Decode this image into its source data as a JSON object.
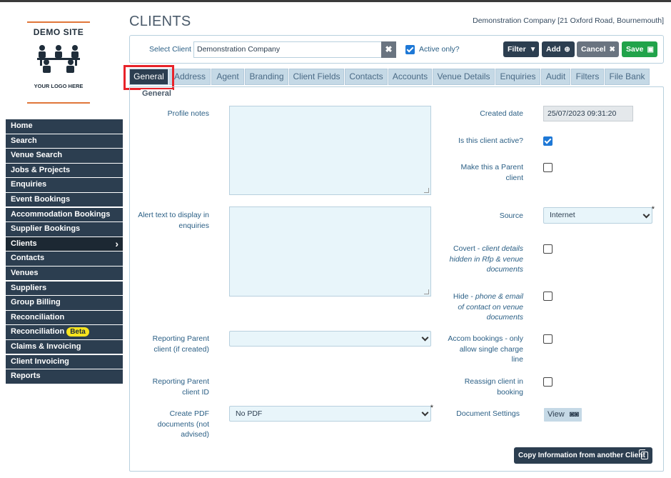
{
  "logo": {
    "brand": "DEMO SITE",
    "tagline": "YOUR LOGO HERE",
    "icon": "people-table-icon"
  },
  "sidebar": {
    "items": [
      {
        "label": "Home"
      },
      {
        "label": "Search"
      },
      {
        "label": "Venue Search"
      },
      {
        "label": "Jobs & Projects"
      },
      {
        "label": "Enquiries"
      },
      {
        "label": "Event Bookings"
      },
      {
        "label": "Accommodation Bookings"
      },
      {
        "label": "Supplier Bookings"
      },
      {
        "label": "Clients",
        "active": true
      },
      {
        "label": "Contacts"
      },
      {
        "label": "Venues"
      },
      {
        "label": "Suppliers"
      },
      {
        "label": "Group Billing"
      },
      {
        "label": "Reconciliation"
      },
      {
        "label": "Reconciliation",
        "badge": "Beta"
      },
      {
        "label": "Claims & Invoicing"
      },
      {
        "label": "Client Invoicing"
      },
      {
        "label": "Reports"
      }
    ]
  },
  "header": {
    "title": "CLIENTS",
    "company": "Demonstration Company [21 Oxford Road, Bournemouth]"
  },
  "select_bar": {
    "label": "Select Client",
    "value": "Demonstration Company",
    "active_only_label": "Active only?",
    "active_only_checked": true,
    "buttons": {
      "filter": "Filter",
      "add": "Add",
      "cancel": "Cancel",
      "save": "Save"
    }
  },
  "tabs": [
    "General",
    "Address",
    "Agent",
    "Branding",
    "Client Fields",
    "Contacts",
    "Accounts",
    "Venue Details",
    "Enquiries",
    "Audit",
    "Filters",
    "File Bank"
  ],
  "active_tab": "General",
  "form": {
    "section_title": "General",
    "profile_notes_label": "Profile notes",
    "alert_text_label_1": "Alert text to display in",
    "alert_text_label_2": "enquiries",
    "reporting_parent_label_1": "Reporting Parent",
    "reporting_parent_label_2": "client (if created)",
    "reporting_parent_value": "",
    "reporting_parent_id_label_1": "Reporting Parent",
    "reporting_parent_id_label_2": "client ID",
    "create_pdf_label_1": "Create PDF",
    "create_pdf_label_2": "documents (not",
    "create_pdf_label_3": "advised)",
    "create_pdf_value": "No PDF",
    "created_date_label": "Created date",
    "created_date_value": "25/07/2023 09:31:20",
    "is_active_label": "Is this client active?",
    "is_active_checked": true,
    "make_parent_label_1": "Make this a Parent",
    "make_parent_label_2": "client",
    "source_label": "Source",
    "source_value": "Internet",
    "covert_label_1": "Covert -",
    "covert_label_1b": "client details",
    "covert_label_2": "hidden in Rfp & venue",
    "covert_label_3": "documents",
    "hide_label_1": "Hide -",
    "hide_label_1b": "phone & email",
    "hide_label_2": "of contact on venue",
    "hide_label_3": "documents",
    "accom_label_1": "Accom bookings - only",
    "accom_label_2": "allow single charge",
    "accom_label_3": "line",
    "reassign_label_1": "Reassign client in",
    "reassign_label_2": "booking",
    "doc_settings_label": "Document Settings",
    "view_button": "View",
    "copy_button": "Copy Information from another Client"
  },
  "colors": {
    "nav": "#2c3e50",
    "accent_blue": "#1e78d6",
    "save_green": "#21a34a",
    "highlight_red": "#e8232a"
  }
}
